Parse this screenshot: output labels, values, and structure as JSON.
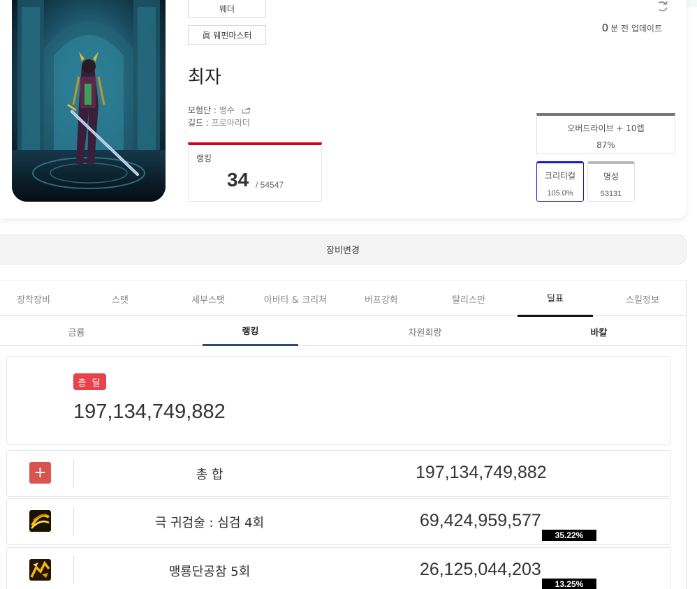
{
  "profile": {
    "job_tag": "웨더",
    "awakening_tag": "眞 웨펀마스터",
    "character_name": "최자",
    "adventure_label": "모험단 : ",
    "adventure_value": "맹수",
    "guild_label": "길드 : ",
    "guild_value": "프로아라더",
    "ranking": {
      "label": "랭킹",
      "rank": "34",
      "total": "/ 54547"
    },
    "update": {
      "minutes": "0",
      "text": "분 전 업데이트"
    },
    "stats": {
      "overdrive_label": "오버드라이브 + 10렙",
      "overdrive_value": "87%",
      "crit_label": "크리티컬",
      "crit_value": "105.0%",
      "fame_label": "명성",
      "fame_value": "53131"
    }
  },
  "equip_change_label": "장비변경",
  "main_tabs": [
    {
      "label": "장착장비",
      "active": false
    },
    {
      "label": "스탯",
      "active": false
    },
    {
      "label": "세부스탯",
      "active": false
    },
    {
      "label": "아바타 & 크리쳐",
      "active": false
    },
    {
      "label": "버프강화",
      "active": false
    },
    {
      "label": "탈리스만",
      "active": false
    },
    {
      "label": "딜표",
      "active": true
    },
    {
      "label": "스킬정보",
      "active": false
    }
  ],
  "sub_tabs": [
    {
      "label": "금룡",
      "active": false
    },
    {
      "label": "랭킹",
      "active": true
    },
    {
      "label": "차원회랑",
      "active": false
    },
    {
      "label": "바칼",
      "active": false
    }
  ],
  "total_damage": {
    "badge": "총 딜",
    "value": "197,134,749,882"
  },
  "skills": [
    {
      "name": "총 합",
      "damage": "197,134,749,882",
      "percent": "",
      "icon": "plus-icon"
    },
    {
      "name": "극 귀검술 : 심검 4회",
      "damage": "69,424,959,577",
      "percent": "35.22%",
      "icon": "sword-slash-skill-icon"
    },
    {
      "name": "맹룡단공참 5회",
      "damage": "26,125,044,203",
      "percent": "13.25%",
      "icon": "dragon-strike-skill-icon"
    }
  ],
  "colors": {
    "rank_accent": "#d3001e",
    "crit_accent": "#1a1ad0",
    "badge_red": "#e8424a",
    "subtab_underline": "#2d4a7a"
  }
}
